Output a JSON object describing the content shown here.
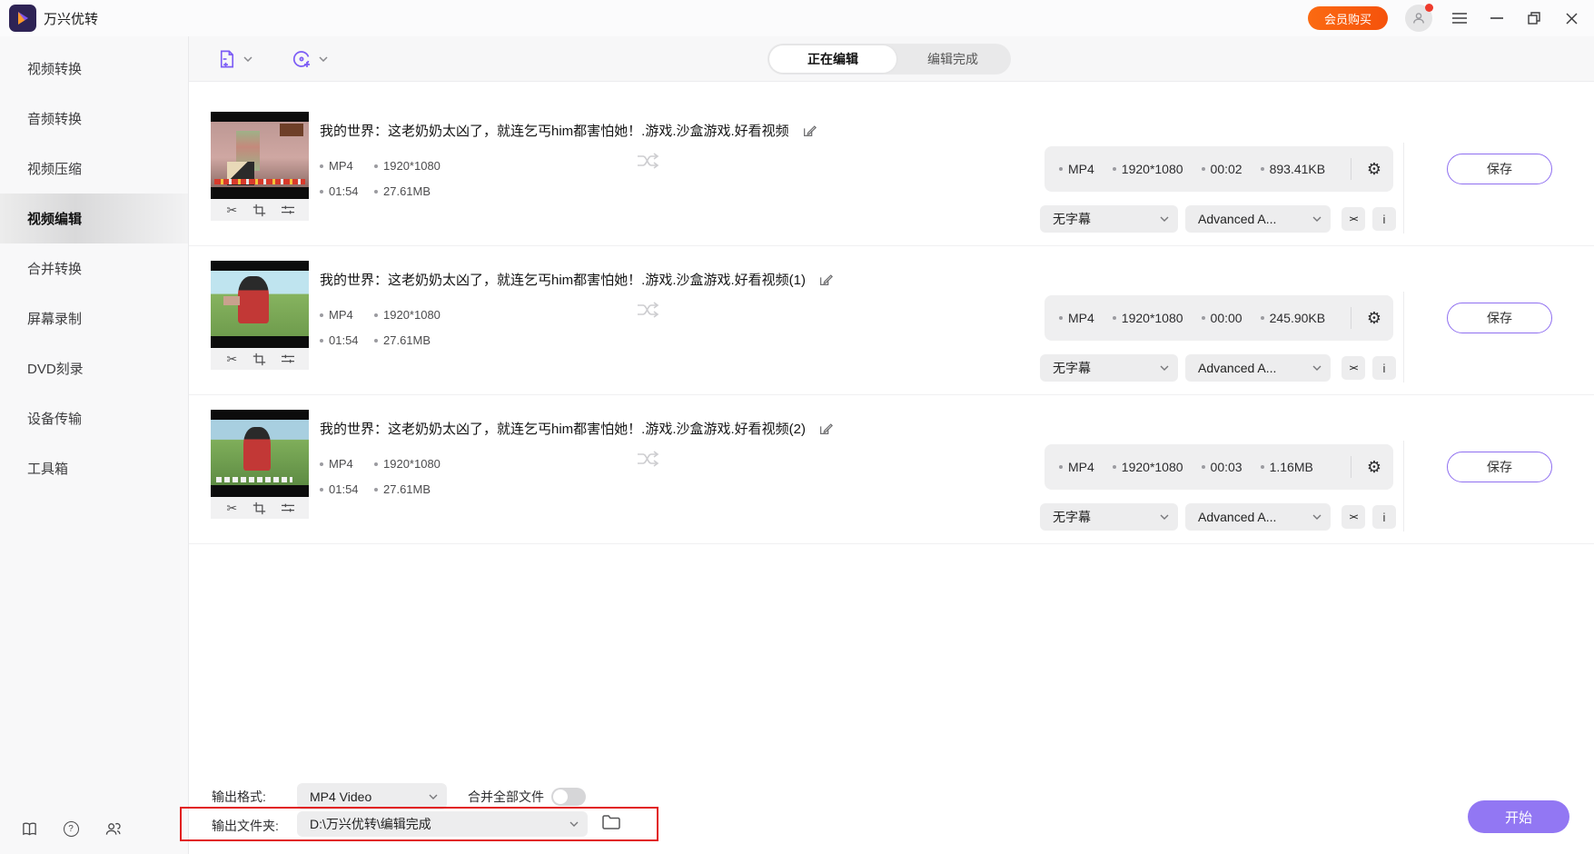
{
  "titlebar": {
    "app_title": "万兴优转",
    "buy_button": "会员购买"
  },
  "sidebar": {
    "items": [
      {
        "label": "视频转换"
      },
      {
        "label": "音频转换"
      },
      {
        "label": "视频压缩"
      },
      {
        "label": "视频编辑"
      },
      {
        "label": "合并转换"
      },
      {
        "label": "屏幕录制"
      },
      {
        "label": "DVD刻录"
      },
      {
        "label": "设备传输"
      },
      {
        "label": "工具箱"
      }
    ],
    "active_index": 3
  },
  "toolbar": {
    "tab_editing": "正在编辑",
    "tab_finished": "编辑完成"
  },
  "items": [
    {
      "title": "我的世界：这老奶奶太凶了，就连乞丐him都害怕她！.游戏.沙盒游戏.好看视频",
      "src_format": "MP4",
      "src_resolution": "1920*1080",
      "src_duration": "01:54",
      "src_size": "27.61MB",
      "out_format": "MP4",
      "out_resolution": "1920*1080",
      "out_duration": "00:02",
      "out_size": "893.41KB",
      "subtitle": "无字幕",
      "audio": "Advanced A...",
      "save_label": "保存"
    },
    {
      "title": "我的世界：这老奶奶太凶了，就连乞丐him都害怕她！.游戏.沙盒游戏.好看视频(1)",
      "src_format": "MP4",
      "src_resolution": "1920*1080",
      "src_duration": "01:54",
      "src_size": "27.61MB",
      "out_format": "MP4",
      "out_resolution": "1920*1080",
      "out_duration": "00:00",
      "out_size": "245.90KB",
      "subtitle": "无字幕",
      "audio": "Advanced A...",
      "save_label": "保存"
    },
    {
      "title": "我的世界：这老奶奶太凶了，就连乞丐him都害怕她！.游戏.沙盒游戏.好看视频(2)",
      "src_format": "MP4",
      "src_resolution": "1920*1080",
      "src_duration": "01:54",
      "src_size": "27.61MB",
      "out_format": "MP4",
      "out_resolution": "1920*1080",
      "out_duration": "00:03",
      "out_size": "1.16MB",
      "subtitle": "无字幕",
      "audio": "Advanced A...",
      "save_label": "保存"
    }
  ],
  "footer": {
    "output_format_label": "输出格式:",
    "output_format_value": "MP4 Video",
    "merge_label": "合并全部文件",
    "output_folder_label": "输出文件夹:",
    "output_folder_value": "D:\\万兴优转\\编辑完成",
    "start_button": "开始"
  },
  "icons": {
    "gear": "⚙",
    "compare": "><",
    "info": "i",
    "help": "?",
    "scissors": "✂"
  },
  "colors": {
    "accent_purple": "#7c5cf5",
    "buy_orange": "#f5520b",
    "highlight_red": "#e11c1c",
    "start_purple": "#9277f3"
  }
}
